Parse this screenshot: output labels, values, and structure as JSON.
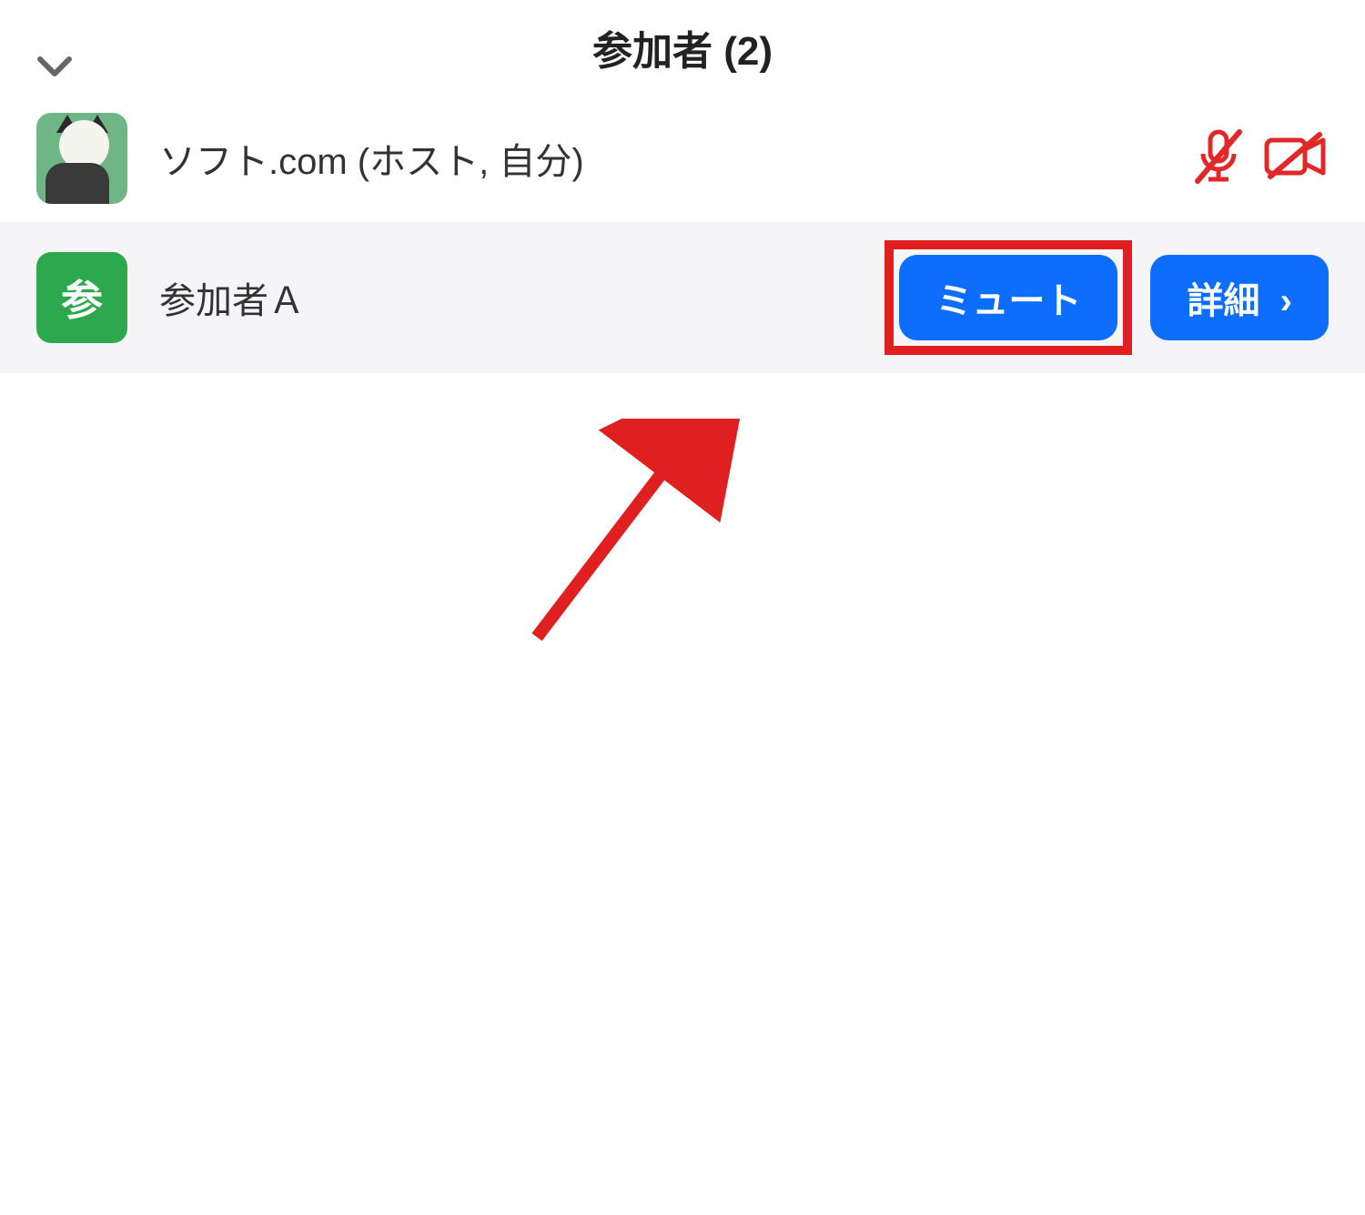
{
  "header": {
    "title": "参加者 (2)"
  },
  "participants": [
    {
      "name": "ソフト.com (ホスト, 自分)",
      "avatar_type": "image",
      "avatar_letter": "",
      "mic_muted": true,
      "cam_off": true
    },
    {
      "name": "参加者Ａ",
      "avatar_type": "letter",
      "avatar_letter": "参",
      "hovered": true
    }
  ],
  "buttons": {
    "mute_label": "ミュート",
    "details_label": "詳細"
  },
  "colors": {
    "highlight": "#e02020",
    "primary": "#0d6efd",
    "avatar_green": "#2ea84f",
    "icon_red": "#e02828"
  }
}
